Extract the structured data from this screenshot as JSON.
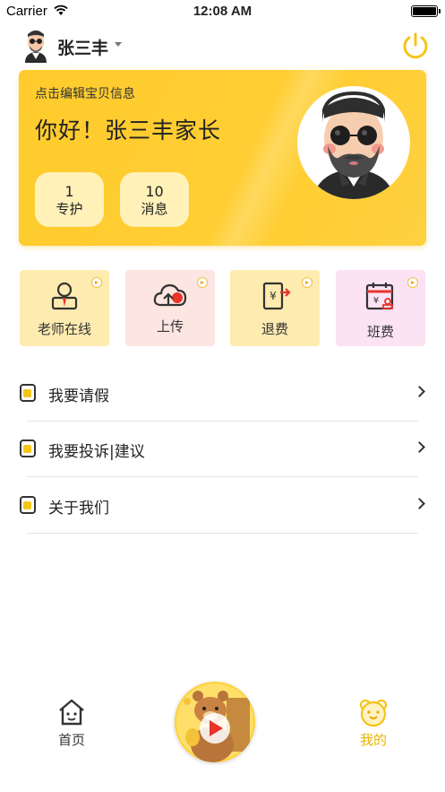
{
  "status_bar": {
    "carrier": "Carrier",
    "time": "12:08 AM"
  },
  "header": {
    "username": "张三丰"
  },
  "card": {
    "hint": "点击编辑宝贝信息",
    "greeting": "你好！张三丰家长",
    "stats": [
      {
        "value": "1",
        "label": "专护"
      },
      {
        "value": "10",
        "label": "消息"
      }
    ]
  },
  "quick_actions": [
    {
      "label": "老师在线",
      "icon": "teacher-icon",
      "bg": "#fdebb0"
    },
    {
      "label": "上传",
      "icon": "cloud-upload-icon",
      "bg": "#fde5e2"
    },
    {
      "label": "退费",
      "icon": "refund-icon",
      "bg": "#fdebb0"
    },
    {
      "label": "班费",
      "icon": "class-fee-icon",
      "bg": "#fbe3f4"
    }
  ],
  "menu": [
    {
      "label": "我要请假",
      "icon": "leave-icon"
    },
    {
      "label": "我要投诉|建议",
      "icon": "complaint-icon"
    },
    {
      "label": "关于我们",
      "icon": "about-icon"
    }
  ],
  "tabs": {
    "home": {
      "label": "首页",
      "color": "#333333"
    },
    "mine": {
      "label": "我的",
      "color": "#e8b400"
    }
  },
  "colors": {
    "accent": "#ffcb2c",
    "power": "#f5c518"
  }
}
